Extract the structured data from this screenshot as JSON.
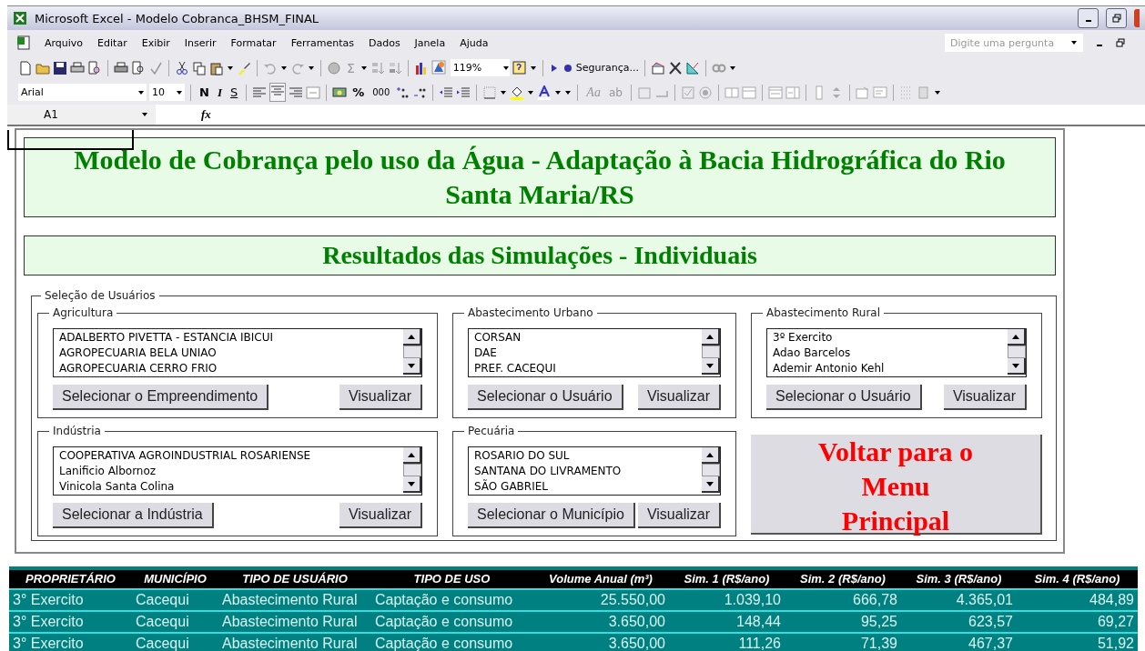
{
  "window": {
    "title": "Microsoft Excel - Modelo Cobranca_BHSM_FINAL"
  },
  "menu": {
    "items": [
      "Arquivo",
      "Editar",
      "Exibir",
      "Inserir",
      "Formatar",
      "Ferramentas",
      "Dados",
      "Janela",
      "Ajuda"
    ],
    "question_box": {
      "placeholder": "Digite uma pergunta"
    }
  },
  "standard_toolbar": {
    "sum_symbol": "Σ",
    "zoom": "119%",
    "security_label": "Segurança..."
  },
  "format_toolbar": {
    "font": "Arial",
    "size": "10",
    "bold": "N",
    "italic": "I",
    "underline": "S",
    "percent": "%",
    "thousands": "000",
    "label_tool": "Aa",
    "textbox_tool": "ab"
  },
  "formula_bar": {
    "name_box": "A1",
    "fx_label": "fx"
  },
  "sheet": {
    "title": "Modelo de Cobrança pelo uso da Água - Adaptação à Bacia Hidrográfica do Rio Santa Maria/RS",
    "subtitle": "Resultados das Simulações - Individuais",
    "selection": {
      "legend": "Seleção de Usuários",
      "groups": [
        {
          "legend": "Agricultura",
          "items": [
            "ADALBERTO PIVETTA - ESTANCIA IBICUI",
            "AGROPECUARIA BELA UNIAO",
            "AGROPECUARIA CERRO FRIO"
          ],
          "select_button": "Selecionar o Empreendimento",
          "view_button": "Visualizar"
        },
        {
          "legend": "Abastecimento Urbano",
          "items": [
            "CORSAN",
            "DAE",
            "PREF. CACEQUI"
          ],
          "select_button": "Selecionar o Usuário",
          "view_button": "Visualizar"
        },
        {
          "legend": "Abastecimento Rural",
          "items": [
            "3º Exercito",
            "Adao Barcelos",
            "Ademir Antonio Kehl"
          ],
          "select_button": "Selecionar o Usuário",
          "view_button": "Visualizar"
        },
        {
          "legend": "Indústria",
          "items": [
            "COOPERATIVA AGROINDUSTRIAL ROSARIENSE",
            "Lanificio Albornoz",
            "Vinicola Santa Colina"
          ],
          "select_button": "Selecionar a Indústria",
          "view_button": "Visualizar"
        },
        {
          "legend": "Pecuária",
          "items": [
            "ROSARIO DO SUL",
            "SANTANA DO LIVRAMENTO",
            "SÃO GABRIEL"
          ],
          "select_button": "Selecionar o Município",
          "view_button": "Visualizar"
        }
      ],
      "back_button": "Voltar para o Menu Principal"
    }
  },
  "table": {
    "columns": [
      "PROPRIETÁRIO",
      "MUNICÍPIO",
      "TIPO DE USUÁRIO",
      "TIPO DE USO",
      "Volume Anual (m³)",
      "Sim. 1 (R$/ano)",
      "Sim. 2 (R$/ano)",
      "Sim. 3 (R$/ano)",
      "Sim. 4 (R$/ano)"
    ],
    "rows": [
      [
        "3° Exercito",
        "Cacequi",
        "Abastecimento Rural",
        "Captação e consumo",
        "25.550,00",
        "1.039,10",
        "666,78",
        "4.365,01",
        "484,89"
      ],
      [
        "3° Exercito",
        "Cacequi",
        "Abastecimento Rural",
        "Captação e consumo",
        "3.650,00",
        "148,44",
        "95,25",
        "623,57",
        "69,27"
      ],
      [
        "3° Exercito",
        "Cacequi",
        "Abastecimento Rural",
        "Captação e consumo",
        "3.650,00",
        "111,26",
        "71,39",
        "467,37",
        "51,92"
      ]
    ]
  }
}
